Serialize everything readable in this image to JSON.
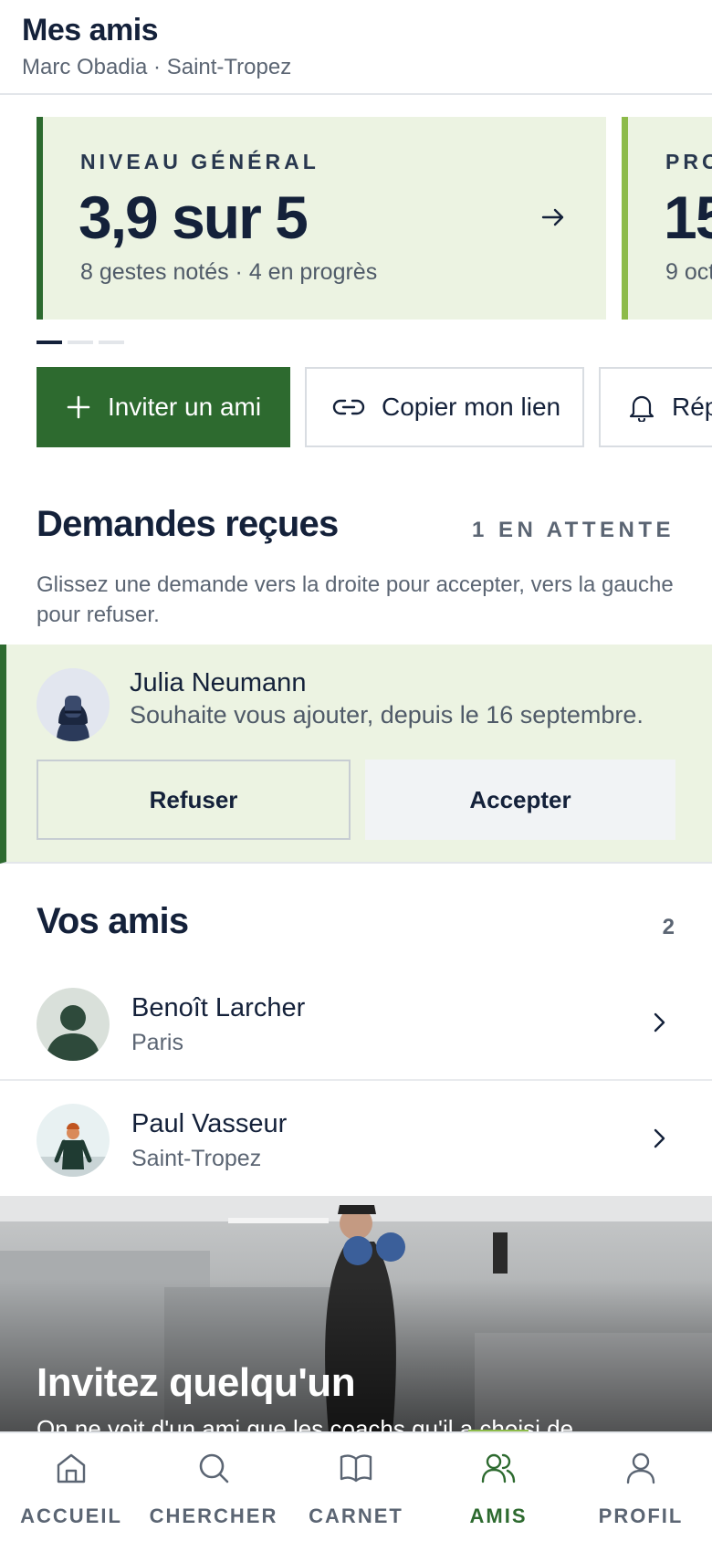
{
  "header": {
    "title": "Mes amis",
    "subtitle": "Marc Obadia · Saint-Tropez"
  },
  "stats": [
    {
      "eyebrow": "NIVEAU GÉNÉRAL",
      "value": "3,9 sur 5",
      "meta": "8 gestes notés · 4 en progrès"
    },
    {
      "eyebrow": "PRO",
      "value": "15",
      "meta": "9 octo"
    }
  ],
  "carousel": {
    "pages": 3,
    "active_index": 0
  },
  "actions": {
    "invite": "Inviter un ami",
    "copy_link": "Copier mon lien",
    "rep": "Rép"
  },
  "requests": {
    "title": "Demandes reçues",
    "pending": "1 EN ATTENTE",
    "hint": "Glissez une demande vers la droite pour accepter, vers la gauche pour refuser.",
    "items": [
      {
        "name": "Julia Neumann",
        "message": "Souhaite vous ajouter, depuis le 16 septembre.",
        "refuse": "Refuser",
        "accept": "Accepter"
      }
    ]
  },
  "friends": {
    "title": "Vos amis",
    "count": "2",
    "items": [
      {
        "name": "Benoît Larcher",
        "city": "Paris"
      },
      {
        "name": "Paul Vasseur",
        "city": "Saint-Tropez"
      }
    ]
  },
  "promo": {
    "title": "Invitez quelqu'un",
    "text": "On ne voit d'un ami que les coachs qu'il a choisi de"
  },
  "tabs": [
    {
      "label": "ACCUEIL",
      "icon": "home-icon"
    },
    {
      "label": "CHERCHER",
      "icon": "search-icon"
    },
    {
      "label": "CARNET",
      "icon": "book-icon"
    },
    {
      "label": "AMIS",
      "icon": "friends-icon",
      "active": true
    },
    {
      "label": "PROFIL",
      "icon": "profile-icon"
    }
  ],
  "colors": {
    "primary": "#2d6a2f",
    "accent_light": "#8dbb4a",
    "card_bg": "#ecf3e2",
    "text": "#14213a",
    "muted": "#5b6573"
  }
}
